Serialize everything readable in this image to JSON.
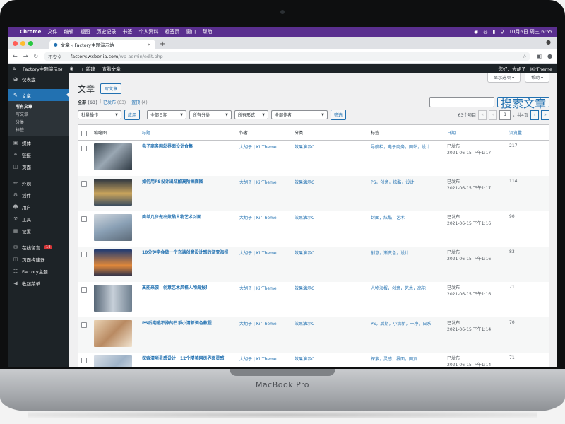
{
  "laptop": {
    "brand": "MacBook Pro"
  },
  "menubar": {
    "app": "Chrome",
    "items": [
      "文件",
      "编辑",
      "视图",
      "历史记录",
      "书签",
      "个人资料",
      "标签页",
      "窗口",
      "帮助"
    ],
    "clock": "10月6日 周三 6:55"
  },
  "browser": {
    "tab_title": "文章 ‹ Factory主题演示站",
    "url_insecure": "不安全",
    "url_host": "factory.wxberjia.com",
    "url_path": "/wp-admin/edit.php"
  },
  "adminbar": {
    "site": "Factory主题演示站",
    "new": "新建",
    "view_posts": "查看文章",
    "greeting": "您好，大胡子 | KirTheme"
  },
  "sidebar": {
    "dashboard": "仪表盘",
    "posts": "文章",
    "sub": [
      "所有文章",
      "写文章",
      "分类",
      "标签"
    ],
    "media": "媒体",
    "links": "链接",
    "pages": "页面",
    "appearance": "外观",
    "plugins": "插件",
    "users": "用户",
    "tools": "工具",
    "settings": "设置",
    "messages": "在线留言",
    "messages_badge": "14",
    "builder": "页面构建器",
    "theme": "Factory主题",
    "collapse": "收起菜单"
  },
  "screen_tabs": {
    "options": "显示选项 ▾",
    "help": "帮助 ▾"
  },
  "page": {
    "title": "文章",
    "add_new": "写文章",
    "views": [
      {
        "label": "全部",
        "count": "(63)"
      },
      {
        "label": "已发布",
        "count": "(63)"
      },
      {
        "label": "置顶",
        "count": "(4)"
      }
    ],
    "search_button": "搜索文章"
  },
  "filters": {
    "bulk": "批量操作",
    "apply": "应用",
    "dates": "全部日期",
    "categories": "所有分类",
    "formats": "所有形式",
    "authors": "全部作者",
    "filter": "筛选"
  },
  "pagination": {
    "count": "63个项目",
    "first": "«",
    "prev": "‹",
    "current": "1",
    "of": "，共4页",
    "next": "›",
    "last": "»"
  },
  "table": {
    "headers": {
      "thumb": "缩略图",
      "title": "标题",
      "author": "作者",
      "category": "分类",
      "tags": "标签",
      "date": "日期",
      "views": "浏览量"
    },
    "rows": [
      {
        "title": "电子商务网站界面设计合集",
        "author": "大胡子 | KirTheme",
        "category": "效果演示C",
        "tags": "导航栏，电子商务，网站，设计",
        "status": "已发布",
        "date": "2021-06-15 下午1:17",
        "views": "217"
      },
      {
        "title": "如何用PS设计出炫酷高阶画面图",
        "author": "大胡子 | KirTheme",
        "category": "效果演示C",
        "tags": "PS，创意，炫酷，设计",
        "status": "已发布",
        "date": "2021-06-15 下午1:17",
        "views": "114"
      },
      {
        "title": "简单几步做出炫酷人物艺术封面",
        "author": "大胡子 | KirTheme",
        "category": "效果演示C",
        "tags": "封面，炫酷，艺术",
        "status": "已发布",
        "date": "2021-06-15 下午1:16",
        "views": "90"
      },
      {
        "title": "10分钟学会做一个充满创意设计感的渐变海报",
        "author": "大胡子 | KirTheme",
        "category": "效果演示C",
        "tags": "创意，渐变色，设计",
        "status": "已发布",
        "date": "2021-06-15 下午1:16",
        "views": "83"
      },
      {
        "title": "高能来袭！创意艺术风格人物海报！",
        "author": "大胡子 | KirTheme",
        "category": "效果演示C",
        "tags": "人物海报，创意，艺术，高能",
        "status": "已发布",
        "date": "2021-06-15 下午1:16",
        "views": "71"
      },
      {
        "title": "PS后期逃不掉的日系小清新调色教程",
        "author": "大胡子 | KirTheme",
        "category": "效果演示C",
        "tags": "PS，后期，小清新，干净，日系",
        "status": "已发布",
        "date": "2021-06-15 下午1:14",
        "views": "70"
      },
      {
        "title": "探索清晰灵感设计！12个精美网页界面灵感",
        "author": "大胡子 | KirTheme",
        "category": "效果演示C",
        "tags": "探索，灵感，界面，网页",
        "status": "已发布",
        "date": "2021-06-15 下午1:14",
        "views": "71"
      }
    ]
  },
  "colors": {
    "wp_blue": "#2271b1",
    "sidebar": "#1d2327",
    "menubar": "#5a2f8f"
  }
}
